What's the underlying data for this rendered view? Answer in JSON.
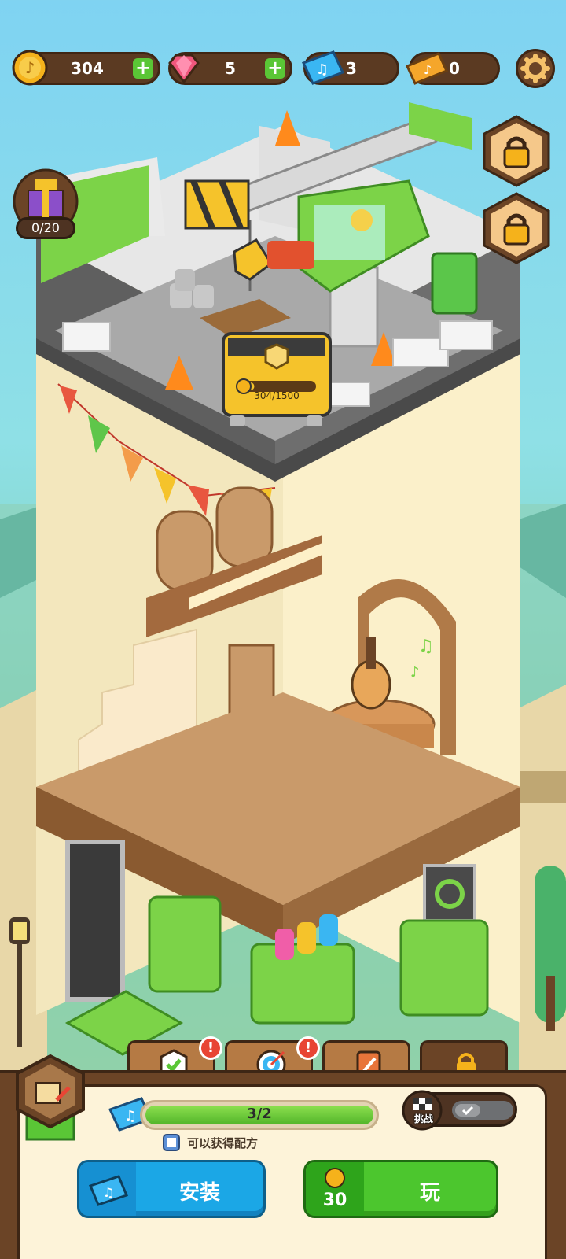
{
  "currencies": [
    {
      "name": "coins",
      "icon": "coin-icon",
      "value": "304"
    },
    {
      "name": "gems",
      "icon": "gem-icon",
      "value": "5"
    },
    {
      "name": "music-tickets",
      "icon": "blue-ticket-icon",
      "value": "3"
    },
    {
      "name": "gold-tickets",
      "icon": "gold-ticket-icon",
      "value": "0"
    }
  ],
  "gift_box": {
    "count": "0/20"
  },
  "locked_floor": {
    "progress_text": "304/1500",
    "progress_fraction": 0.203
  },
  "bottom": {
    "tabs": [
      {
        "name": "tasks",
        "icon": "check-shield-icon",
        "alert": "!"
      },
      {
        "name": "target",
        "icon": "target-icon",
        "alert": "!"
      },
      {
        "name": "decorate",
        "icon": "paint-book-icon"
      },
      {
        "name": "locked",
        "icon": "lock-icon"
      }
    ],
    "progress_text": "3/2",
    "progress_fraction": 1.0,
    "recipe_hint": "可以获得配方",
    "challenge_label": "挑战",
    "install_label": "安装",
    "play_label": "玩",
    "play_cost": "30"
  },
  "colors": {
    "coin": "#f5b21b",
    "gem": "#f0577d",
    "ticket_blue": "#3ab6f2",
    "play_green": "#4cc62e",
    "install_blue": "#1ba7e6"
  }
}
